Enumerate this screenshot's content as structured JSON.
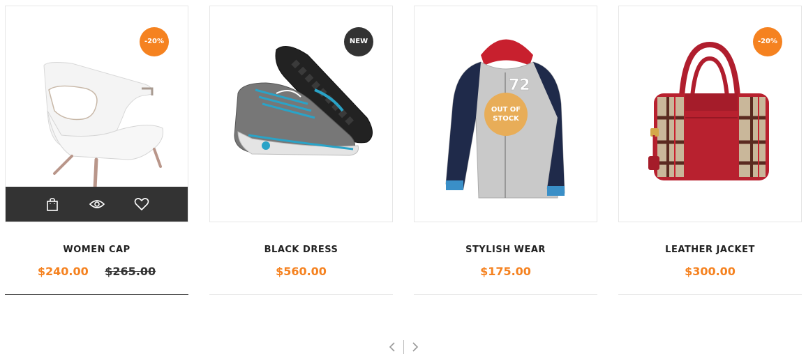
{
  "accent": "#f58220",
  "products": [
    {
      "name": "WOMEN CAP",
      "price": "$240.00",
      "old_price": "$265.00",
      "badge": "-20%"
    },
    {
      "name": "BLACK DRESS",
      "price": "$560.00",
      "badge": "NEW"
    },
    {
      "name": "STYLISH WEAR",
      "price": "$175.00",
      "badge": "OUT OF STOCK"
    },
    {
      "name": "LEATHER JACKET",
      "price": "$300.00",
      "badge": "-20%"
    }
  ],
  "action_icons": [
    "shopping-bag-icon",
    "eye-icon",
    "heart-icon"
  ],
  "pager_icons": [
    "chevron-left-icon",
    "chevron-right-icon"
  ]
}
